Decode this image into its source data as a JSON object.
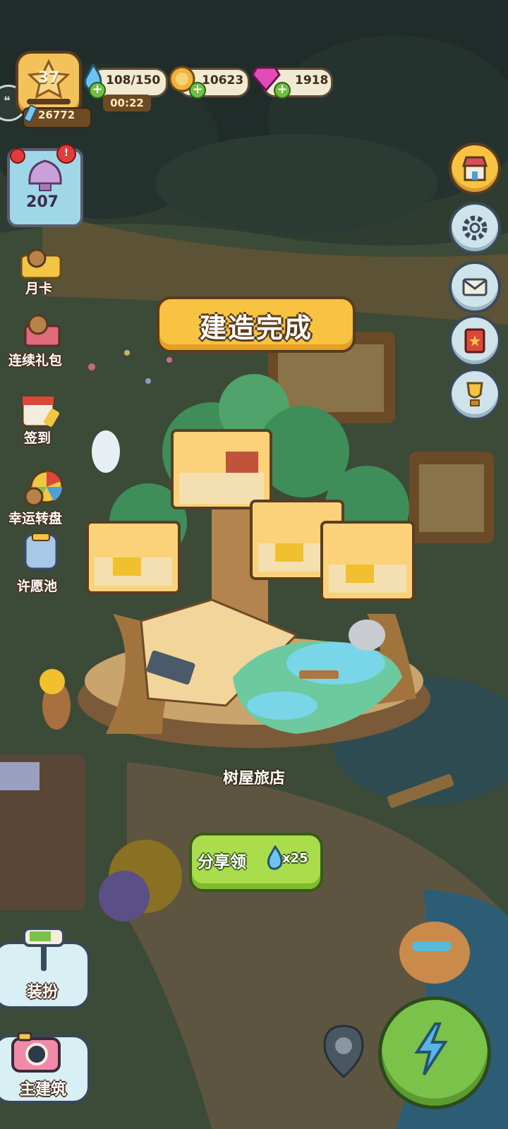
{
  "hud": {
    "level": "37",
    "xp": "26772",
    "energy": "108/150",
    "energy_timer": "00:22",
    "coins": "10623",
    "gems": "1918"
  },
  "shells": {
    "count": "207",
    "badge": "!"
  },
  "left_menu": [
    {
      "label": "月卡",
      "icon": "monthly-card-icon"
    },
    {
      "label": "连续礼包",
      "icon": "gift-pack-icon"
    },
    {
      "label": "签到",
      "icon": "checkin-calendar-icon"
    },
    {
      "label": "幸运转盘",
      "icon": "lucky-wheel-icon"
    },
    {
      "label": "许愿池",
      "icon": "wishing-well-icon"
    }
  ],
  "right_menu": [
    {
      "icon": "shop-icon"
    },
    {
      "icon": "gear-icon"
    },
    {
      "icon": "mail-icon"
    },
    {
      "icon": "book-icon"
    },
    {
      "icon": "trophy-icon"
    }
  ],
  "popup": {
    "title": "建造完成",
    "building_name": "树屋旅店",
    "share_label": "分享领",
    "share_reward": "x25"
  },
  "bottom": {
    "decorate_label": "装扮",
    "main_building_label": "主建筑"
  },
  "colors": {
    "banner": "#f7c341",
    "share_button": "#a9dd4c",
    "energy": "#6cc4f2",
    "coin": "#f0b43a",
    "gem": "#e04db6"
  }
}
